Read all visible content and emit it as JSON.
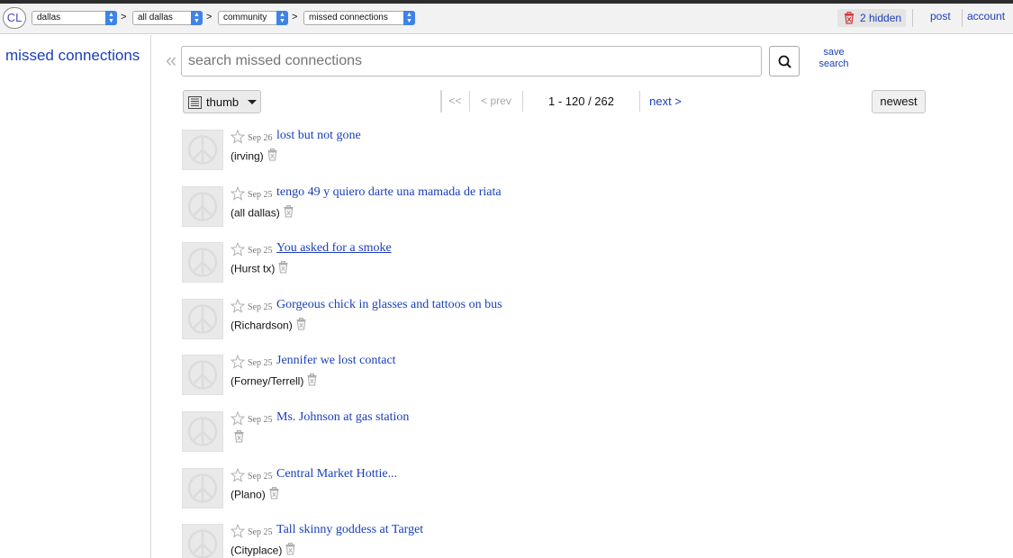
{
  "header": {
    "logo": "CL",
    "breadcrumb": [
      {
        "label": "dallas"
      },
      {
        "label": "all dallas"
      },
      {
        "label": "community"
      },
      {
        "label": "missed connections"
      }
    ],
    "separator": ">",
    "hidden_label": "2 hidden",
    "post_label": "post",
    "account_label": "account"
  },
  "sidebar": {
    "title": "missed connections"
  },
  "search": {
    "placeholder": "search missed connections",
    "save_label": "save search",
    "collapse_glyph": "«"
  },
  "toolbar": {
    "view_label": "thumb",
    "pager": {
      "first": "<<",
      "prev": "< prev",
      "range": "1 - 120 / 262",
      "next": "next >"
    },
    "sort_label": "newest"
  },
  "listings": [
    {
      "date": "Sep 26",
      "title": "lost but not gone",
      "location": "(irving)",
      "visited": false
    },
    {
      "date": "Sep 25",
      "title": "tengo 49 y quiero darte una mamada de riata",
      "location": "(all dallas)",
      "visited": false
    },
    {
      "date": "Sep 25",
      "title": "You asked for a smoke",
      "location": "(Hurst tx)",
      "visited": true
    },
    {
      "date": "Sep 25",
      "title": "Gorgeous chick in glasses and tattoos on bus",
      "location": "(Richardson)",
      "visited": false
    },
    {
      "date": "Sep 25",
      "title": "Jennifer we lost contact",
      "location": "(Forney/Terrell)",
      "visited": false
    },
    {
      "date": "Sep 25",
      "title": "Ms. Johnson at gas station",
      "location": "",
      "visited": false
    },
    {
      "date": "Sep 25",
      "title": "Central Market Hottie...",
      "location": "(Plano)",
      "visited": false
    },
    {
      "date": "Sep 25",
      "title": "Tall skinny goddess at Target",
      "location": "(Cityplace)",
      "visited": false
    }
  ],
  "colors": {
    "link": "#1a3fb8",
    "select_arrow": "#3f83e6",
    "hidden_icon": "#d43c3c"
  },
  "icons": {
    "thumb_placeholder": "peace-icon",
    "favorite": "star-icon",
    "hide": "trash-icon",
    "search": "search-icon",
    "view": "list-icon"
  }
}
